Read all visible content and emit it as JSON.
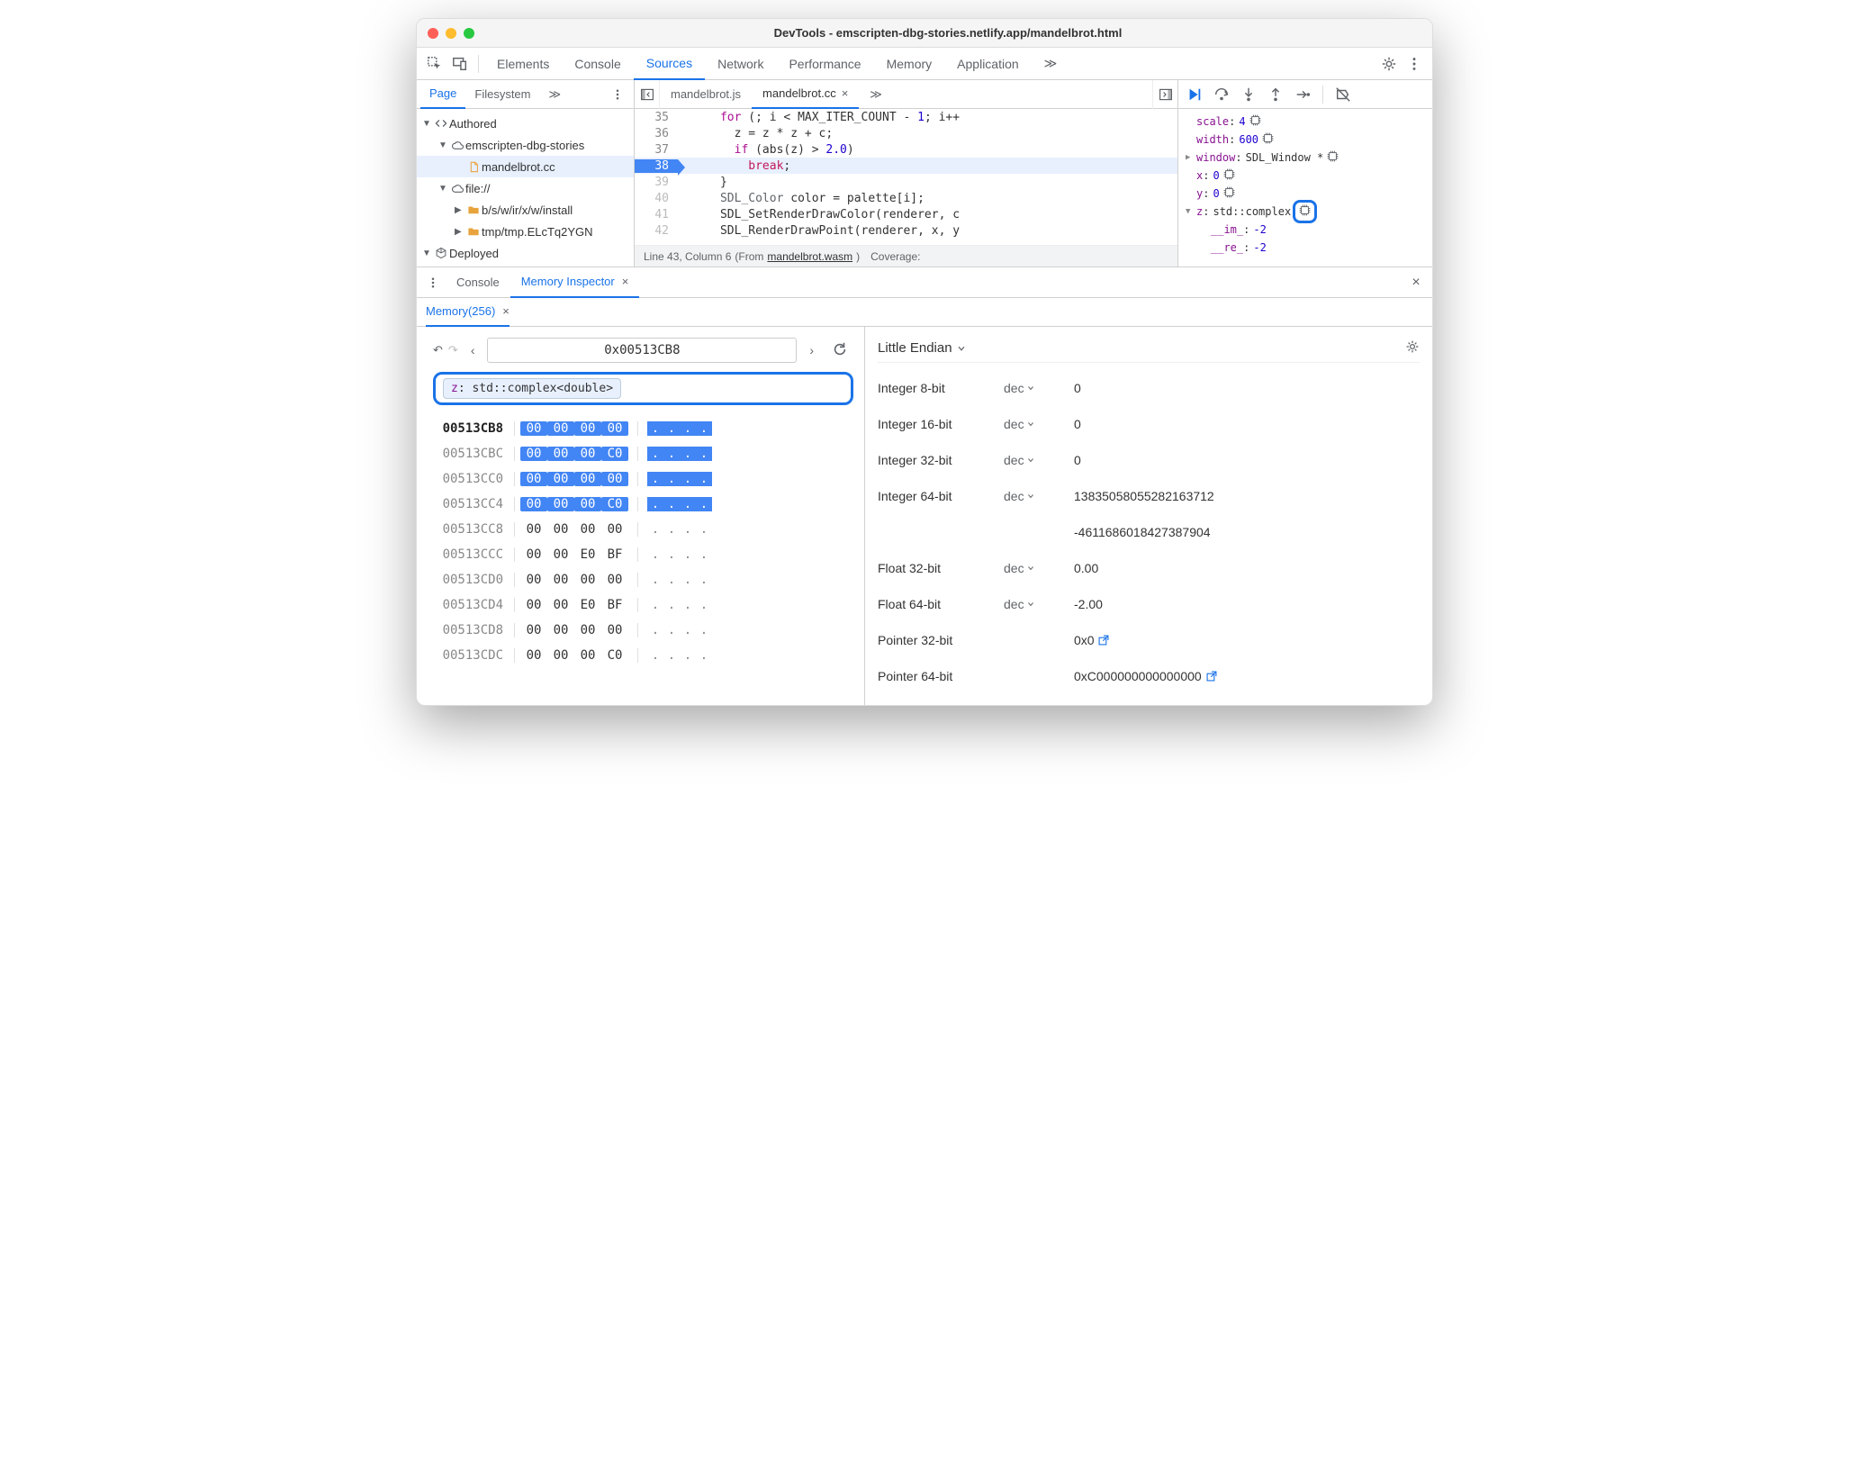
{
  "titlebar": {
    "title": "DevTools - emscripten-dbg-stories.netlify.app/mandelbrot.html"
  },
  "main_tabs": {
    "items": [
      "Elements",
      "Console",
      "Sources",
      "Network",
      "Performance",
      "Memory",
      "Application"
    ],
    "overflow": "≫",
    "active": 2
  },
  "nav": {
    "tabs": [
      "Page",
      "Filesystem"
    ],
    "overflow": "≫",
    "active": 0,
    "tree": [
      {
        "indent": 0,
        "caret": "▼",
        "icon": "code",
        "label": "Authored"
      },
      {
        "indent": 1,
        "caret": "▼",
        "icon": "cloud",
        "label": "emscripten-dbg-stories"
      },
      {
        "indent": 2,
        "caret": "",
        "icon": "file",
        "label": "mandelbrot.cc",
        "selected": true
      },
      {
        "indent": 1,
        "caret": "▼",
        "icon": "cloud",
        "label": "file://"
      },
      {
        "indent": 2,
        "caret": "▶",
        "icon": "folder",
        "label": "b/s/w/ir/x/w/install"
      },
      {
        "indent": 2,
        "caret": "▶",
        "icon": "folder",
        "label": "tmp/tmp.ELcTq2YGN"
      },
      {
        "indent": 0,
        "caret": "▼",
        "icon": "cube",
        "label": "Deployed"
      }
    ]
  },
  "editor": {
    "tabs": [
      {
        "label": "mandelbrot.js",
        "active": false
      },
      {
        "label": "mandelbrot.cc",
        "active": true,
        "closeable": true
      }
    ],
    "overflow": "≫",
    "code": [
      {
        "n": 35,
        "html": "      <span class='kw'>for</span> (; i &lt; MAX_ITER_COUNT - <span class='num'>1</span>; i++"
      },
      {
        "n": 36,
        "html": "        z = z * z + c;"
      },
      {
        "n": 37,
        "html": "        <span class='kw'>if</span> (abs(z) &gt; <span class='num'>2.0</span>)"
      },
      {
        "n": 38,
        "html": "          <span class='brk'>break</span>;",
        "current": true
      },
      {
        "n": 39,
        "html": "      }",
        "after": true
      },
      {
        "n": 40,
        "html": "      <span class='type'>SDL_Color</span> color = palette[i];",
        "after": true
      },
      {
        "n": 41,
        "html": "      SDL_SetRenderDrawColor(renderer, c",
        "after": true
      },
      {
        "n": 42,
        "html": "      SDL_RenderDrawPoint(renderer, x, y",
        "after": true
      }
    ],
    "status": {
      "pos": "Line 43, Column 6",
      "from": "(From ",
      "link": "mandelbrot.wasm",
      "close": ")",
      "coverage": "Coverage:"
    }
  },
  "scope": {
    "rows": [
      {
        "indent": 0,
        "name": "scale",
        "value": "4",
        "mem_icon": true,
        "num": true
      },
      {
        "indent": 0,
        "name": "width",
        "value": "600",
        "mem_icon": true,
        "num": true
      },
      {
        "indent": 0,
        "caret": "▶",
        "name": "window",
        "value": "SDL_Window *",
        "mem_icon": true
      },
      {
        "indent": 0,
        "name": "x",
        "value": "0",
        "mem_icon": true,
        "num": true
      },
      {
        "indent": 0,
        "name": "y",
        "value": "0",
        "mem_icon": true,
        "num": true
      },
      {
        "indent": 0,
        "caret": "▼",
        "name": "z",
        "value": "std::complex<double>",
        "mem_icon": true,
        "mem_icon_highlight": true
      },
      {
        "indent": 1,
        "name": "__im_",
        "value": "-2",
        "num": true
      },
      {
        "indent": 1,
        "name": "__re_",
        "value": "-2",
        "num": true
      }
    ]
  },
  "drawer": {
    "tabs": [
      {
        "label": "Console",
        "active": false
      },
      {
        "label": "Memory Inspector",
        "active": true,
        "closeable": true
      }
    ],
    "sub_tab": "Memory(256)"
  },
  "memory": {
    "address": "0x00513CB8",
    "chip_z": "z",
    "chip_rest": ": std::complex<double>",
    "rows": [
      {
        "addr": "00513CB8",
        "bold": true,
        "bytes": [
          "00",
          "00",
          "00",
          "00"
        ],
        "hl": [
          0,
          1,
          2,
          3
        ],
        "ascii": [
          ".",
          ".",
          ".",
          "."
        ],
        "ahl": [
          0,
          1,
          2,
          3
        ]
      },
      {
        "addr": "00513CBC",
        "bytes": [
          "00",
          "00",
          "00",
          "C0"
        ],
        "hl": [
          0,
          1,
          2,
          3
        ],
        "ascii": [
          ".",
          ".",
          ".",
          "."
        ],
        "ahl": [
          0,
          1,
          2,
          3
        ]
      },
      {
        "addr": "00513CC0",
        "bytes": [
          "00",
          "00",
          "00",
          "00"
        ],
        "hl": [
          0,
          1,
          2,
          3
        ],
        "ascii": [
          ".",
          ".",
          ".",
          "."
        ],
        "ahl": [
          0,
          1,
          2,
          3
        ]
      },
      {
        "addr": "00513CC4",
        "bytes": [
          "00",
          "00",
          "00",
          "C0"
        ],
        "hl": [
          0,
          1,
          2,
          3
        ],
        "ascii": [
          ".",
          ".",
          ".",
          "."
        ],
        "ahl": [
          0,
          1,
          2,
          3
        ]
      },
      {
        "addr": "00513CC8",
        "bytes": [
          "00",
          "00",
          "00",
          "00"
        ],
        "hl": [],
        "ascii": [
          ".",
          ".",
          ".",
          "."
        ],
        "ahl": []
      },
      {
        "addr": "00513CCC",
        "bytes": [
          "00",
          "00",
          "E0",
          "BF"
        ],
        "hl": [],
        "ascii": [
          ".",
          ".",
          ".",
          "."
        ],
        "ahl": []
      },
      {
        "addr": "00513CD0",
        "bytes": [
          "00",
          "00",
          "00",
          "00"
        ],
        "hl": [],
        "ascii": [
          ".",
          ".",
          ".",
          "."
        ],
        "ahl": []
      },
      {
        "addr": "00513CD4",
        "bytes": [
          "00",
          "00",
          "E0",
          "BF"
        ],
        "hl": [],
        "ascii": [
          ".",
          ".",
          ".",
          "."
        ],
        "ahl": []
      },
      {
        "addr": "00513CD8",
        "bytes": [
          "00",
          "00",
          "00",
          "00"
        ],
        "hl": [],
        "ascii": [
          ".",
          ".",
          ".",
          "."
        ],
        "ahl": []
      },
      {
        "addr": "00513CDC",
        "bytes": [
          "00",
          "00",
          "00",
          "C0"
        ],
        "hl": [],
        "ascii": [
          ".",
          ".",
          ".",
          "."
        ],
        "ahl": []
      }
    ]
  },
  "values": {
    "endian": "Little Endian",
    "rows": [
      {
        "type": "Integer 8-bit",
        "fmt": "dec",
        "val": "0"
      },
      {
        "type": "Integer 16-bit",
        "fmt": "dec",
        "val": "0"
      },
      {
        "type": "Integer 32-bit",
        "fmt": "dec",
        "val": "0"
      },
      {
        "type": "Integer 64-bit",
        "fmt": "dec",
        "val": "13835058055282163712"
      },
      {
        "type": "",
        "fmt": "",
        "val": "-4611686018427387904"
      },
      {
        "type": "Float 32-bit",
        "fmt": "dec",
        "val": "0.00"
      },
      {
        "type": "Float 64-bit",
        "fmt": "dec",
        "val": "-2.00"
      },
      {
        "type": "Pointer 32-bit",
        "fmt": "",
        "val": "0x0",
        "ext": true
      },
      {
        "type": "Pointer 64-bit",
        "fmt": "",
        "val": "0xC000000000000000",
        "ext": true
      }
    ]
  }
}
